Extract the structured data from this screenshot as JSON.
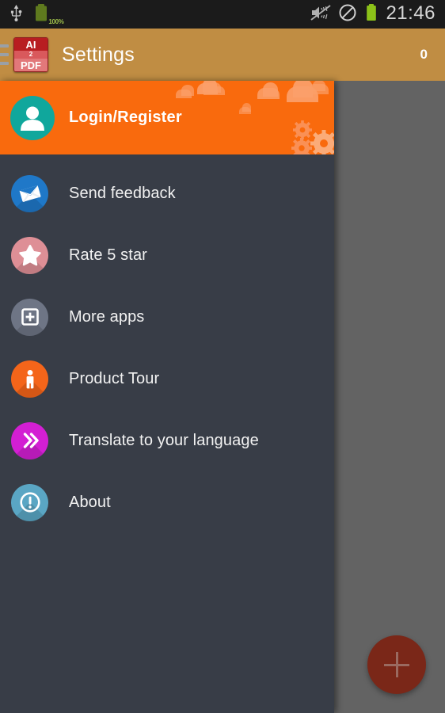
{
  "status_bar": {
    "clock": "21:46",
    "battery_percent": "100%",
    "left_icons": [
      {
        "name": "usb-icon",
        "label": "USB connected"
      },
      {
        "name": "battery-charge-icon",
        "label": "Battery 100%"
      }
    ],
    "right_icons": [
      {
        "name": "vibrate-off-icon",
        "label": "Sound muted"
      },
      {
        "name": "do-not-disturb-icon",
        "label": "Do not disturb"
      },
      {
        "name": "battery-icon",
        "label": "Battery full"
      }
    ],
    "background_color": "#1b1b1b"
  },
  "action_bar": {
    "title": "Settings",
    "count": "0",
    "app_icon": {
      "name": "ai2pdf-app-icon",
      "top_text": "AI",
      "mid_text": "2",
      "bottom_text": "PDF"
    },
    "menu_icon": "hamburger-menu-icon",
    "background_color": "#c08d43"
  },
  "drawer": {
    "background_color": "#383d47",
    "header": {
      "label": "Login/Register",
      "avatar_icon": "user-avatar-icon",
      "background_color": "#f96a0d",
      "decoration_color": "#fba06a"
    },
    "items": [
      {
        "label": "Send feedback",
        "icon": "envelope-icon",
        "icon_color": "#1f78c8"
      },
      {
        "label": "Rate 5 star",
        "icon": "star-icon",
        "icon_color": "#de8f96"
      },
      {
        "label": "More apps",
        "icon": "add-box-icon",
        "icon_color": "#6e7585"
      },
      {
        "label": "Product Tour",
        "icon": "pedestrian-icon",
        "icon_color": "#f4651a"
      },
      {
        "label": "Translate to your language",
        "icon": "double-chevron-icon",
        "icon_color": "#d31fd3"
      },
      {
        "label": "About",
        "icon": "info-exclamation-icon",
        "icon_color": "#5aa6c4"
      }
    ]
  },
  "content": {
    "scrim_color": "#636363",
    "fab": {
      "name": "add-fab",
      "icon": "plus-icon",
      "color": "#7a2718"
    }
  }
}
